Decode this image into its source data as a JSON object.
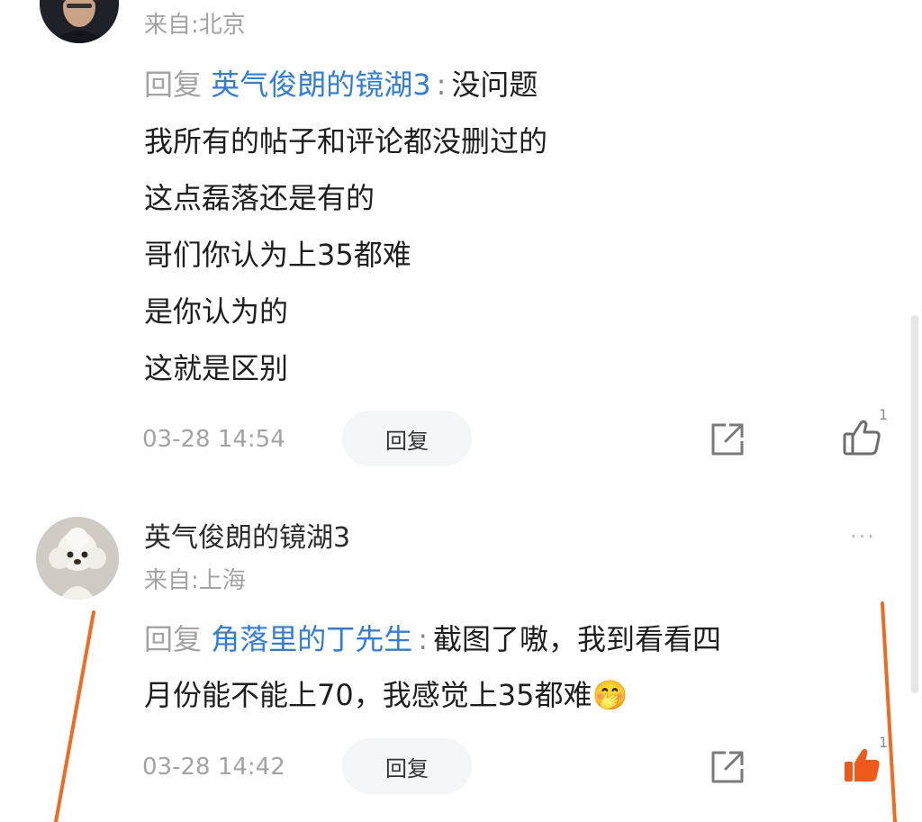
{
  "colors": {
    "link_blue": "#2f7de1",
    "meta_gray": "#a3a3a3",
    "liked_orange": "#ef5a1a",
    "annotation_orange": "#f06a1f"
  },
  "comments": [
    {
      "location": "来自:北京",
      "reply_prefix": "回复",
      "reply_target": "英气俊朗的镜湖3",
      "reply_colon": ":",
      "first_line_text": "没问题",
      "lines": [
        "我所有的帖子和评论都没删过的",
        "这点磊落还是有的",
        "哥们你认为上35都难",
        "是你认为的",
        "这就是区别"
      ],
      "timestamp": "03-28 14:54",
      "reply_button": "回复",
      "like_count": "1",
      "liked": false,
      "avatar_icon": "user-photo-avatar"
    },
    {
      "username": "英气俊朗的镜湖3",
      "location": "来自:上海",
      "more_label": "···",
      "reply_prefix": "回复",
      "reply_target": "角落里的丁先生",
      "reply_colon": ":",
      "first_line_text": "截图了嗷，我到看看四",
      "lines": [
        "月份能不能上70，我感觉上35都难"
      ],
      "emoji": "🤭",
      "timestamp": "03-28 14:42",
      "reply_button": "回复",
      "like_count": "1",
      "liked": true,
      "avatar_icon": "poodle-dog-avatar"
    }
  ]
}
